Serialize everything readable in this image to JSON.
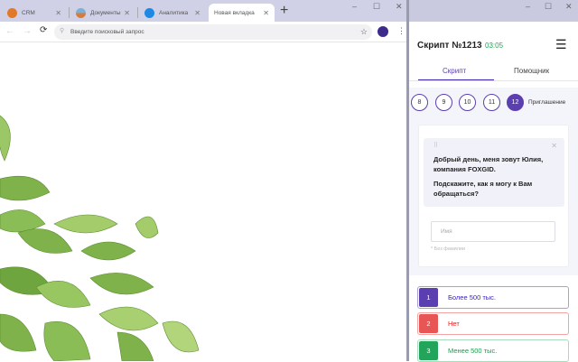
{
  "browser": {
    "tabs": [
      {
        "label": "CRM",
        "active": false
      },
      {
        "label": "Документы",
        "active": false
      },
      {
        "label": "Аналитика",
        "active": false
      },
      {
        "label": "Новая вкладка",
        "active": true
      }
    ],
    "new_tab": "+",
    "address_placeholder": "Введите поисковый запрос"
  },
  "panel": {
    "title": "Скрипт №1213",
    "timer": "03:05",
    "tabs": [
      {
        "label": "Скрипт",
        "active": true
      },
      {
        "label": "Помощник",
        "active": false
      }
    ],
    "steps": [
      "8",
      "9",
      "10",
      "11",
      "12"
    ],
    "active_step": "12",
    "step_label": "Приглашение",
    "message": [
      "Добрый день, меня зовут Юлия, компания FOXGID.",
      "Подскажите, как я могу к Вам обращаться?"
    ],
    "name_placeholder": "Имя",
    "hint": "* Без фамилии",
    "answers": [
      {
        "num": "1",
        "label": "Более 500 тыс.",
        "color": "#5b3fb0"
      },
      {
        "num": "2",
        "label": "Нет",
        "color": "#e85555"
      },
      {
        "num": "3",
        "label": "Менее 500 тыс.",
        "color": "#22a55a"
      }
    ]
  },
  "colors": {
    "accent": "#5b3fb0",
    "timer": "#22a55a"
  }
}
